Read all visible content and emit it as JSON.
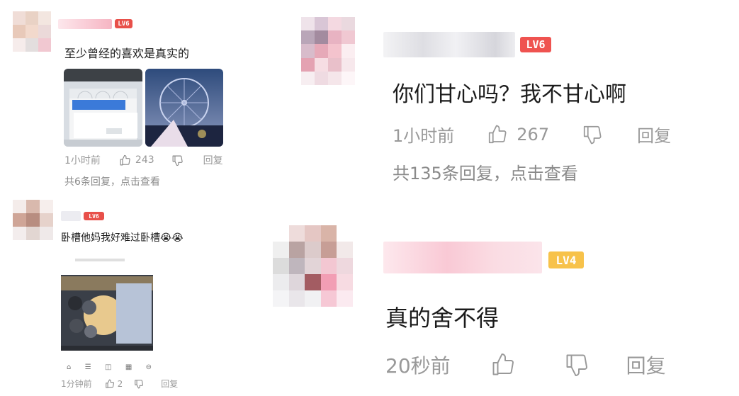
{
  "left_top": {
    "level": "LV6",
    "comment": "至少曾经的喜欢是真实的",
    "time": "1小时前",
    "likes": "243",
    "reply_label": "回复",
    "sub_replies": "共6条回复，点击查看",
    "colors": {
      "level_badge": "#e8504a",
      "name_blur": "#f5b7c3"
    }
  },
  "left_bottom": {
    "level": "LV6",
    "comment": "卧槽他妈我好难过卧槽",
    "emoji": [
      "😭",
      "😭"
    ],
    "time": "1分钟前",
    "likes": "2",
    "reply_label": "回复"
  },
  "right_top": {
    "level": "LV6",
    "comment": "你们甘心吗？我不甘心啊",
    "time": "1小时前",
    "likes": "267",
    "reply_label": "回复",
    "sub_replies": "共135条回复，点击查看",
    "colors": {
      "level_badge": "#ef5350"
    }
  },
  "right_bottom": {
    "level": "LV4",
    "comment": "真的舍不得",
    "time": "20秒前",
    "reply_label": "回复",
    "colors": {
      "level_badge": "#f7c24a"
    }
  },
  "icons": [
    "thumbs-up-icon",
    "thumbs-down-icon"
  ]
}
